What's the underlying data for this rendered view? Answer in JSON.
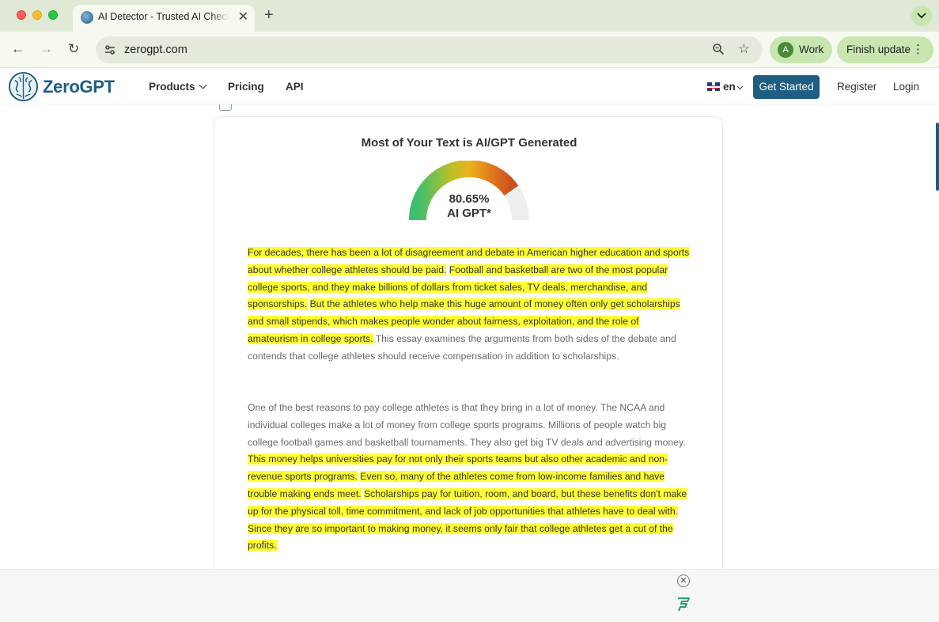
{
  "browser": {
    "tab_title": "AI Detector - Trusted AI Checker",
    "tab_close": "✕",
    "new_tab": "+",
    "url": "zerogpt.com",
    "profile_initial": "A",
    "profile_label": "Work",
    "update_label": "Finish update",
    "back": "←",
    "forward": "→",
    "reload": "↻",
    "star": "☆",
    "kebab": "⋮",
    "tab_menu": "⌄"
  },
  "header": {
    "logo": "ZeroGPT",
    "nav": {
      "products": "Products",
      "pricing": "Pricing",
      "api": "API"
    },
    "lang": "en",
    "get_started": "Get Started",
    "register": "Register",
    "login": "Login"
  },
  "result": {
    "title": "Most of Your Text is AI/GPT Generated",
    "percent": "80.65%",
    "label": "AI GPT*",
    "ai_fraction": 0.8065
  },
  "paragraph1": [
    {
      "text": "For decades, there has been a lot of disagreement and debate in American higher education and sports about whether college athletes should be paid.",
      "ai": true
    },
    {
      "text": "Football and basketball are two of the most popular college sports, and they make billions of dollars from ticket sales, TV deals, merchandise, and sponsorships.",
      "ai": true
    },
    {
      "text": "But the athletes who help make this huge amount of money often only get scholarships and small stipends, which makes people wonder about fairness, exploitation, and the role of amateurism in college sports.",
      "ai": true
    },
    {
      "text": "This essay examines the arguments from both sides of the debate and contends that college athletes should receive compensation in addition to scholarships.",
      "ai": false
    }
  ],
  "paragraph2": [
    {
      "text": "One of the best reasons to pay college athletes is that they bring in a lot of money. The NCAA and individual colleges make a lot of money from college sports programs. Millions of people watch big college football games and basketball tournaments. They also get big TV deals and advertising money.",
      "ai": false
    },
    {
      "text": "This money helps universities pay for not only their sports teams but also other academic and non-revenue sports programs.",
      "ai": true
    },
    {
      "text": "Even so, many of the athletes come from low-income families and have trouble making ends meet.",
      "ai": true
    },
    {
      "text": "Scholarships pay for tuition, room, and board, but these benefits don't make up for the physical toll, time commitment, and lack of job opportunities that athletes have to deal with.",
      "ai": true
    },
    {
      "text": "Since they are so important to making money, it seems only fair that college athletes get a cut of the profits.",
      "ai": true
    }
  ],
  "ad": {
    "close": "✕"
  },
  "colors": {
    "brand": "#1f5d82",
    "highlight": "#ffff33",
    "chrome": "#dfe9d6"
  },
  "icons": [
    "site-info-icon",
    "zoom-icon",
    "star-icon",
    "kebab-icon",
    "ad-close-icon",
    "ad-logo-icon"
  ]
}
